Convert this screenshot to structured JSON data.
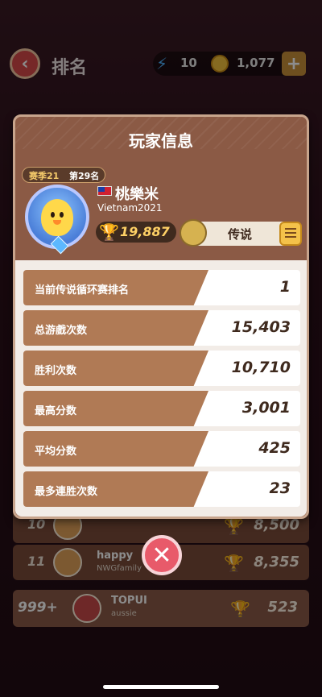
{
  "header": {
    "title": "排名",
    "energy": "10",
    "coins": "1,077",
    "plus_label": "+"
  },
  "background_rows": [
    {
      "rank": "10",
      "name": "",
      "sub": "",
      "score": "8,500"
    },
    {
      "rank": "11",
      "name": "happy",
      "sub": "NWGfamily",
      "score": "8,355"
    }
  ],
  "my_row": {
    "rank": "999+",
    "name": "TOPUI",
    "sub": "aussie",
    "score": "523"
  },
  "modal": {
    "title": "玩家信息",
    "season_label": "赛季21",
    "season_rank": "第29名",
    "player_name": "桃樂米",
    "country": "Vietnam2021",
    "trophies": "19,887",
    "tier": "传说",
    "stats": [
      {
        "label": "当前传说循环赛排名",
        "value": "1"
      },
      {
        "label": "总游戲次数",
        "value": "15,403"
      },
      {
        "label": "胜利次数",
        "value": "10,710"
      },
      {
        "label": "最高分数",
        "value": "3,001"
      },
      {
        "label": "平均分数",
        "value": "425"
      },
      {
        "label": "最多連胜次数",
        "value": "23"
      }
    ],
    "close_label": "✕"
  },
  "icons": [
    "back-arrow-icon",
    "bolt-icon",
    "coin-icon",
    "trophy-icon",
    "gem-icon",
    "flag-icon",
    "note-icon",
    "close-icon"
  ]
}
